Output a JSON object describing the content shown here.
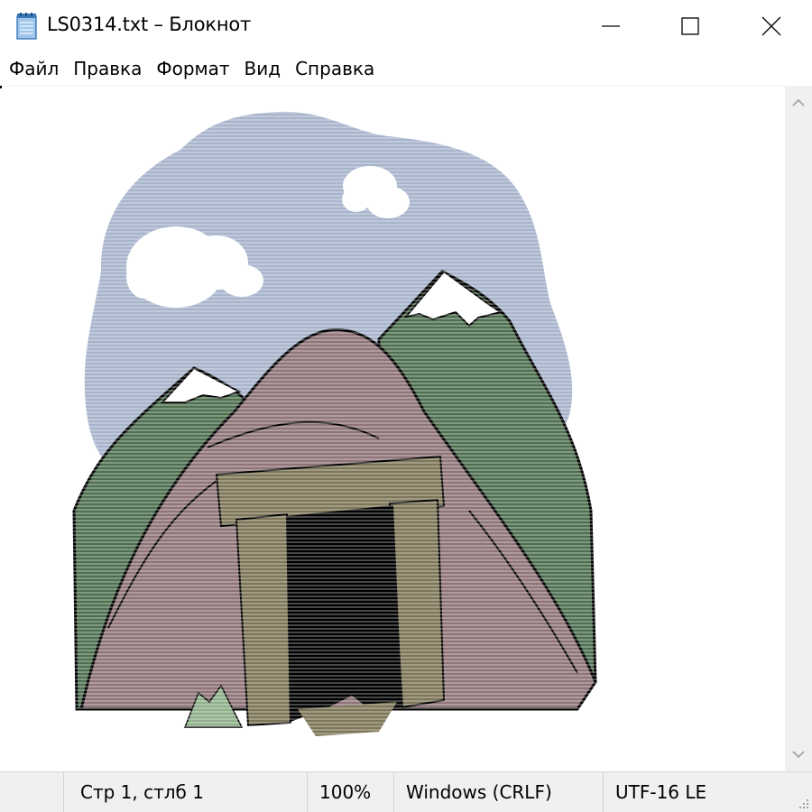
{
  "window": {
    "title": "LS0314.txt – Блокнот"
  },
  "menu": {
    "items": [
      "Файл",
      "Правка",
      "Формат",
      "Вид",
      "Справка"
    ]
  },
  "statusbar": {
    "position": "Стр 1, стлб 1",
    "zoom": "100%",
    "line_endings": "Windows (CRLF)",
    "encoding": "UTF-16 LE"
  },
  "icons": {
    "app": "notepad-icon",
    "minimize": "minimize-icon",
    "maximize": "maximize-icon",
    "close": "close-icon",
    "scroll_up": "chevron-up-icon",
    "scroll_down": "chevron-down-icon",
    "grip": "resize-grip-icon"
  },
  "colors": {
    "sky": "#a7b4cc",
    "cloud": "#ffffff",
    "mountain": "#4f7050",
    "snow": "#ffffff",
    "hill": "#8f7478",
    "stone": "#7e7658",
    "doorway": "#000000",
    "grass": "#8fb08a"
  }
}
